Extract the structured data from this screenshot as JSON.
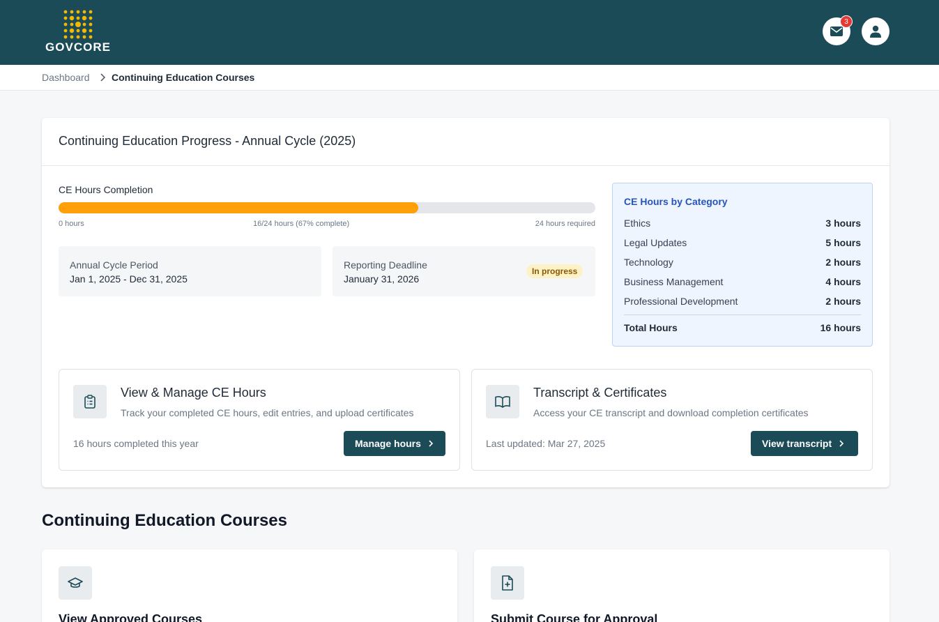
{
  "header": {
    "logo_text": "GOVCORE",
    "notification_count": "3",
    "icons": [
      "mail-icon",
      "user-icon"
    ]
  },
  "breadcrumb": {
    "home": "Dashboard",
    "current": "Continuing Education Courses"
  },
  "progress": {
    "title": "Continuing Education Progress - Annual Cycle (2025)",
    "completion_label": "CE Hours Completion",
    "percent": 0.67,
    "min_label": "0 hours",
    "status_label": "16/24 hours (67% complete)",
    "max_label": "24 hours required",
    "cycle_label": "Annual Cycle Period",
    "cycle_value": "Jan 1, 2025 - Dec 31, 2025",
    "deadline_label": "Reporting Deadline",
    "deadline_value": "January 31, 2026",
    "status_pill": "In progress"
  },
  "categories": {
    "title": "CE Hours by Category",
    "items": [
      {
        "name": "Ethics",
        "value": "3 hours"
      },
      {
        "name": "Legal Updates",
        "value": "5 hours"
      },
      {
        "name": "Technology",
        "value": "2 hours"
      },
      {
        "name": "Business Management",
        "value": "4 hours"
      },
      {
        "name": "Professional Development",
        "value": "2 hours"
      }
    ],
    "total_label": "Total Hours",
    "total_value": "16 hours"
  },
  "actions": [
    {
      "title": "View & Manage CE Hours",
      "description": "Track your completed CE hours, edit entries, and upload certificates",
      "meta": "16 hours completed this year",
      "button": "Manage hours",
      "icon": "clipboard-icon"
    },
    {
      "title": "Transcript & Certificates",
      "description": "Access your CE transcript and download completion certificates",
      "meta": "Last updated: Mar 27, 2025",
      "button": "View transcript",
      "icon": "book-icon"
    }
  ],
  "courses": {
    "section_title": "Continuing Education Courses",
    "items": [
      {
        "title": "View Approved Courses",
        "icon": "graduation-cap-icon"
      },
      {
        "title": "Submit Course for Approval",
        "icon": "document-plus-icon"
      }
    ]
  },
  "colors": {
    "header_bg": "#1b4b57",
    "progress_fill": "#ff9f0a",
    "logo_accent": "#f5b800",
    "category_title": "#2654b8",
    "badge_red": "#e53935"
  }
}
